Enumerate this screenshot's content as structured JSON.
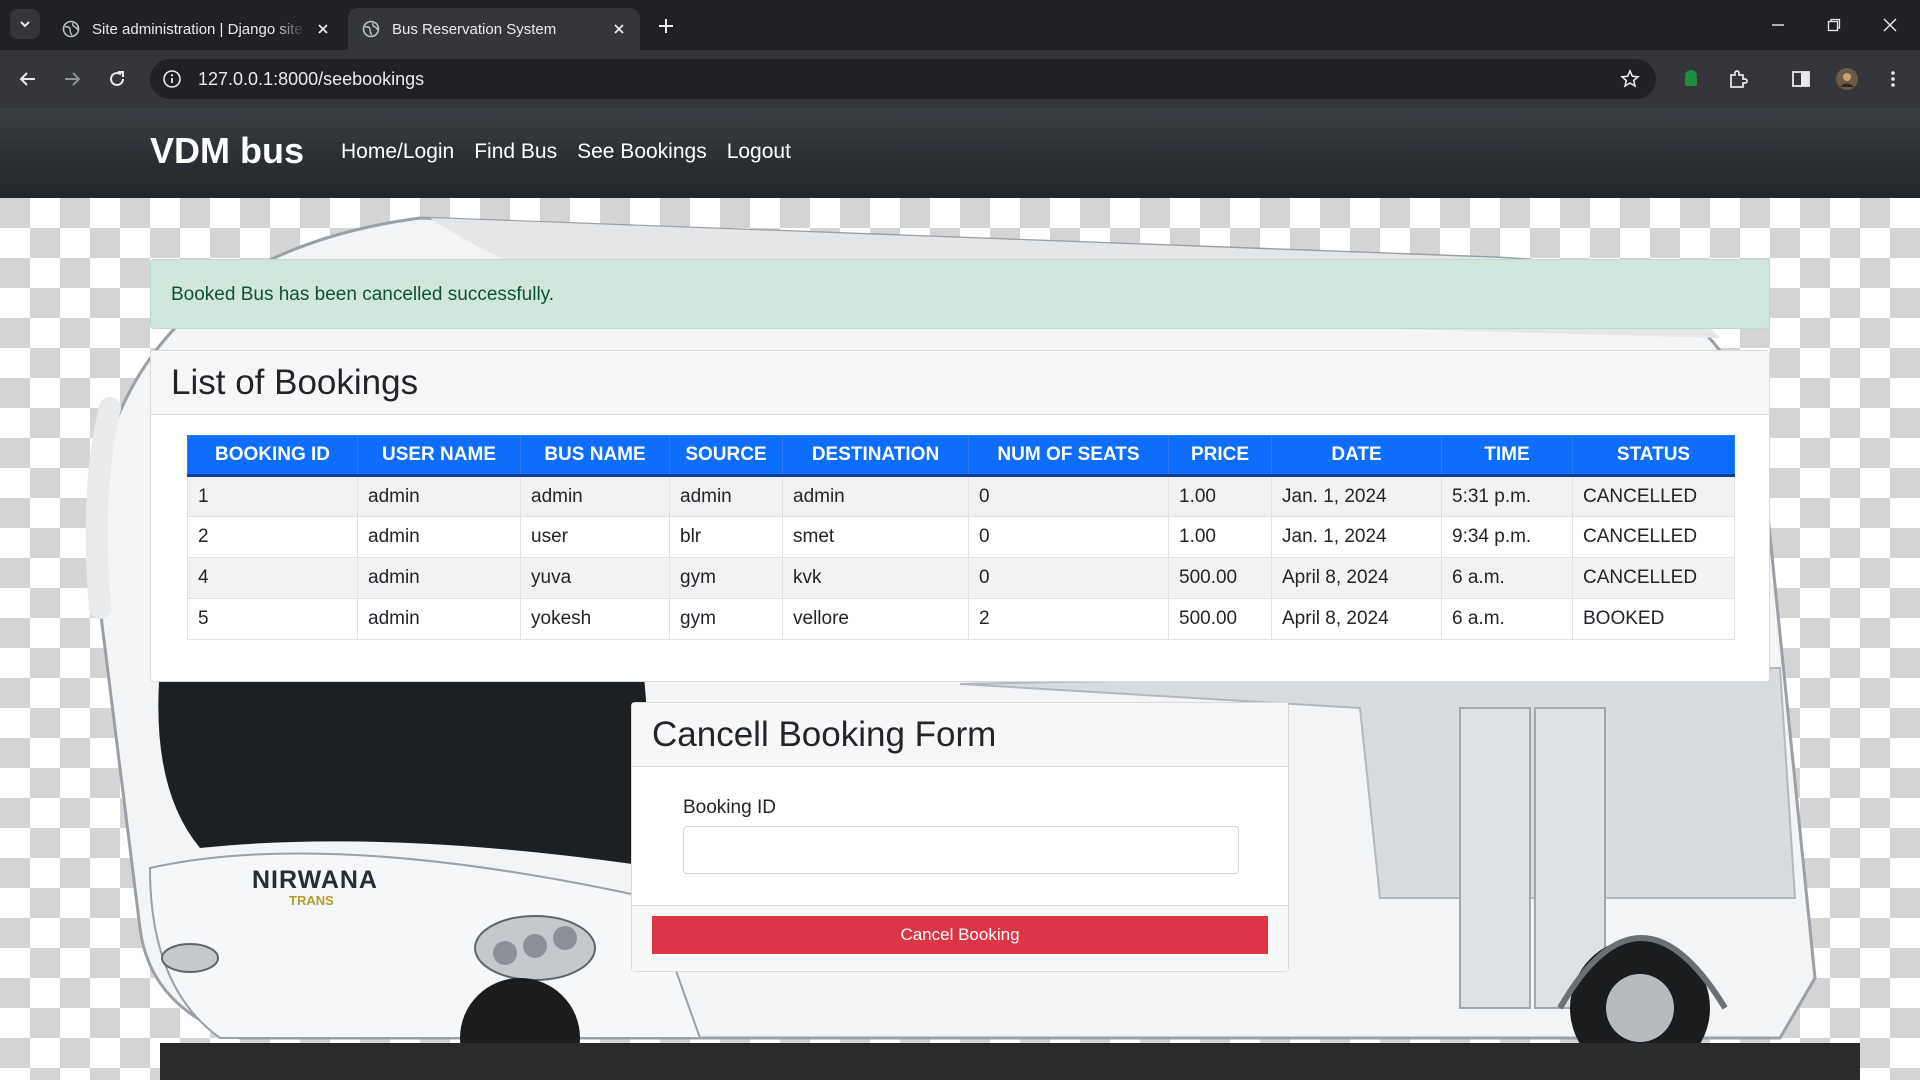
{
  "browser": {
    "tabs": [
      {
        "title": "Site administration | Django site admin",
        "active": false
      },
      {
        "title": "Bus Reservation System",
        "active": true
      }
    ],
    "url": "127.0.0.1:8000/seebookings"
  },
  "navbar": {
    "brand": "VDM bus",
    "links": [
      "Home/Login",
      "Find Bus",
      "See Bookings",
      "Logout"
    ]
  },
  "alert": {
    "message": "Booked Bus has been cancelled successfully.",
    "color": "#d1e7dd"
  },
  "bookings": {
    "title": "List of Bookings",
    "columns": [
      "BOOKING ID",
      "USER NAME",
      "BUS NAME",
      "SOURCE",
      "DESTINATION",
      "NUM OF SEATS",
      "PRICE",
      "DATE",
      "TIME",
      "STATUS"
    ],
    "rows": [
      [
        "1",
        "admin",
        "admin",
        "admin",
        "admin",
        "0",
        "1.00",
        "Jan. 1, 2024",
        "5:31 p.m.",
        "CANCELLED"
      ],
      [
        "2",
        "admin",
        "user",
        "blr",
        "smet",
        "0",
        "1.00",
        "Jan. 1, 2024",
        "9:34 p.m.",
        "CANCELLED"
      ],
      [
        "4",
        "admin",
        "yuva",
        "gym",
        "kvk",
        "0",
        "500.00",
        "April 8, 2024",
        "6 a.m.",
        "CANCELLED"
      ],
      [
        "5",
        "admin",
        "yokesh",
        "gym",
        "vellore",
        "2",
        "500.00",
        "April 8, 2024",
        "6 a.m.",
        "BOOKED"
      ]
    ],
    "header_color": "#0d6efd"
  },
  "cancel_form": {
    "title": "Cancell Booking Form",
    "field_label": "Booking ID",
    "field_value": "",
    "button_label": "Cancel Booking",
    "button_color": "#dc3545"
  },
  "background_logo": {
    "brand": "NIRWANA",
    "sub": "TRANS"
  }
}
